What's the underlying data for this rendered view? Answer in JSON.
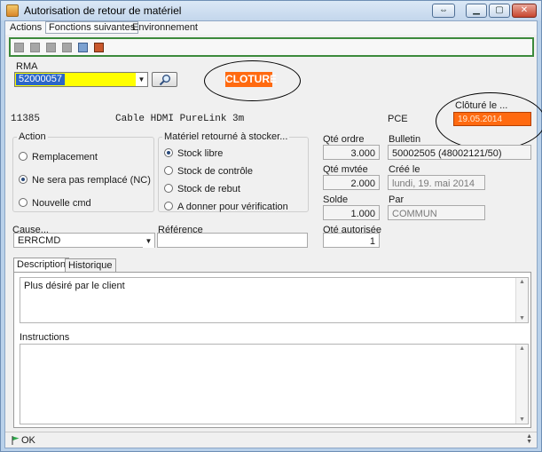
{
  "window": {
    "title": "Autorisation de retour de matériel"
  },
  "menu": {
    "items": [
      "Actions",
      "Fonctions suivantes",
      "Environnement"
    ]
  },
  "rma": {
    "label": "RMA",
    "value": "52000057",
    "status": "CLOTURE"
  },
  "item": {
    "code": "11385",
    "description": "Cable HDMI PureLink 3m",
    "unit": "PCE"
  },
  "closed": {
    "label": "Clôturé le ...",
    "value": "19.05.2014"
  },
  "action_group": {
    "title": "Action",
    "options": [
      "Remplacement",
      "Ne sera pas remplacé (NC)",
      "Nouvelle cmd"
    ],
    "selected": "Ne sera pas remplacé (NC)"
  },
  "stock_group": {
    "title": "Matériel retourné à stocker...",
    "options": [
      "Stock libre",
      "Stock de contrôle",
      "Stock de rebut",
      "A donner pour vérification"
    ],
    "selected": "Stock libre"
  },
  "quantities": {
    "ordered_label": "Qté ordre",
    "ordered_value": "3.000",
    "moved_label": "Qté mvtée",
    "moved_value": "2.000",
    "balance_label": "Solde",
    "balance_value": "1.000",
    "authorized_label": "Qté autorisée",
    "authorized_value": "1"
  },
  "bulletin": {
    "label": "Bulletin",
    "value": "50002505 (48002121/50)"
  },
  "created": {
    "label": "Créé le",
    "value": "lundi, 19. mai 2014"
  },
  "by": {
    "label": "Par",
    "value": "COMMUN"
  },
  "cause": {
    "label": "Cause...",
    "value": "ERRCMD"
  },
  "reference": {
    "label": "Référence",
    "value": ""
  },
  "tabs": [
    {
      "label": "Description"
    },
    {
      "label": "Historique"
    }
  ],
  "description": {
    "text": "Plus désiré par le client"
  },
  "instructions": {
    "label": "Instructions",
    "text": ""
  },
  "status": {
    "text": "OK"
  },
  "colors": {
    "highlight_orange": "#ff6a10",
    "rma_yellow": "#ffff00",
    "toolbar_border": "#3c8a3c"
  },
  "icons": {
    "app": "app-icon",
    "search": "magnifier-icon",
    "print": "printer-icon",
    "exit": "exit-door-icon",
    "status": "green-flag-icon"
  }
}
